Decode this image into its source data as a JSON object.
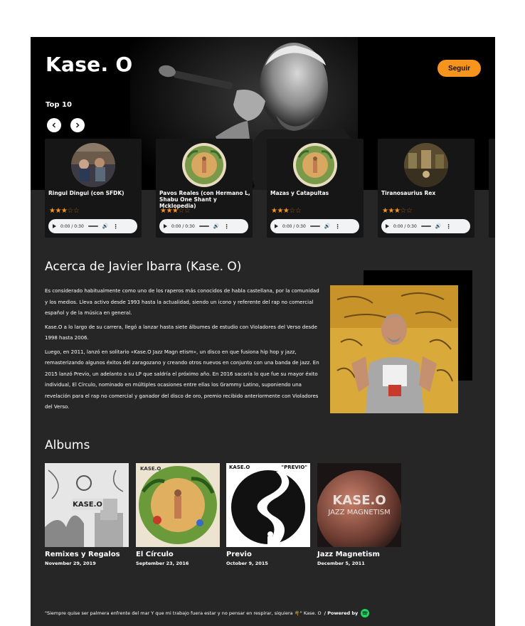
{
  "artist": {
    "name": "Kase. O",
    "follow_label": "Seguir"
  },
  "top_section": {
    "label": "Top 10"
  },
  "tracks": [
    {
      "title": "Ringui Dingui (con SFDK)",
      "stars": 3,
      "time": "0:00 / 0:30"
    },
    {
      "title": "Pavos Reales (con Hermano L, Shabu One Shant y Mcklopedia)",
      "stars": 3,
      "time": "0:00 / 0:30"
    },
    {
      "title": "Mazas y Catapultas",
      "stars": 3,
      "time": "0:00 / 0:30"
    },
    {
      "title": "Tiranosaurius Rex",
      "stars": 3,
      "time": "0:00 / 0:30"
    }
  ],
  "about": {
    "title": "Acerca de Javier Ibarra (Kase. O)",
    "paragraphs": [
      "Es considerado habitualmente como uno de los raperos más conocidos de habla castellana, por la comunidad y los medios. Lleva activo desde 1993 hasta la actualidad, siendo un icono y referente del rap no comercial español y de la música en general.",
      "Kase.O a lo largo de su carrera, llegó a lanzar hasta siete álbumes de estudio con Violadores del Verso desde 1998 hasta 2006.",
      "Luego, en 2011, lanzó en solitario «Kase.O Jazz Magn etism», un disco en que fusiona hip hop y jazz, remasterizando algunos éxitos del zaragozano y creando otros nuevos en conjunto con una banda de jazz. En 2015 lanzó Previo, un adelanto a su LP que saldría el próximo año. En 2016 sacaría lo que fue su mayor éxito individual, El Círculo, nominado en múltiples ocasiones entre ellas los Grammy Latino, suponiendo una revelación para el rap no comercial y ganador del disco de oro, premio recibido anteriormente con Violadores del Verso."
    ]
  },
  "albums": {
    "title": "Albums",
    "items": [
      {
        "name": "Remixes y Regalos",
        "date": "November 29, 2019"
      },
      {
        "name": "El Círculo",
        "date": "September 23, 2016"
      },
      {
        "name": "Previo",
        "date": "October 9, 2015"
      },
      {
        "name": "Jazz Magnetism",
        "date": "December 5, 2011"
      }
    ]
  },
  "footer": {
    "quote": "\"Siempre quise ser palmera enfrente del mar Y que mi trabajo fuera estar y no pensar en respirar, siquiera 🌴\" Kase. O",
    "powered": " / Powered by"
  },
  "colors": {
    "accent": "#f7941d",
    "background": "#262626",
    "card": "#161616",
    "spotify": "#1ed760"
  },
  "icons": {
    "prev": "chevron-left-icon",
    "next": "chevron-right-icon",
    "spotify": "spotify-icon"
  }
}
